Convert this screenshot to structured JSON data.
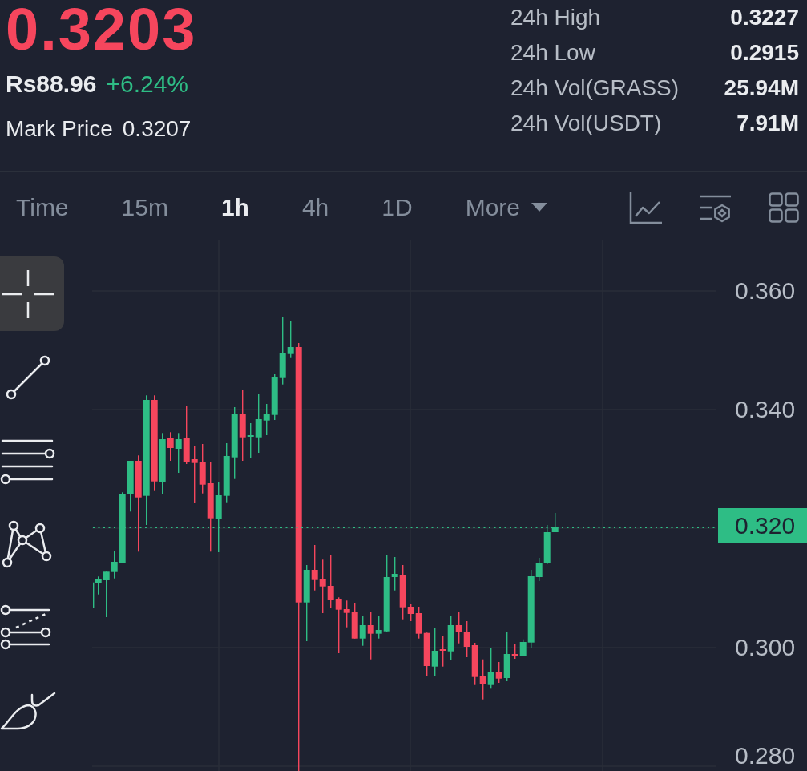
{
  "ticker": {
    "last_price": "0.3203",
    "fiat_price": "Rs88.96",
    "change": "+6.24%",
    "mark_price_label": "Mark Price",
    "mark_price": "0.3207"
  },
  "stats": [
    {
      "label": "24h High",
      "value": "0.3227"
    },
    {
      "label": "24h Low",
      "value": "0.2915"
    },
    {
      "label": "24h Vol(GRASS)",
      "value": "25.94M"
    },
    {
      "label": "24h Vol(USDT)",
      "value": "7.91M"
    }
  ],
  "intervals": [
    {
      "label": "Time",
      "selected": false,
      "kind": "tab"
    },
    {
      "label": "15m",
      "selected": false,
      "kind": "tab"
    },
    {
      "label": "1h",
      "selected": true,
      "kind": "tab"
    },
    {
      "label": "4h",
      "selected": false,
      "kind": "tab"
    },
    {
      "label": "1D",
      "selected": false,
      "kind": "tab"
    },
    {
      "label": "More",
      "selected": false,
      "kind": "menu"
    }
  ],
  "drawing_tools": [
    {
      "selected": true
    },
    {
      "selected": false
    },
    {
      "selected": false
    },
    {
      "selected": false
    },
    {
      "selected": false
    },
    {
      "selected": false
    }
  ],
  "chart": {
    "price_labels": [
      "0.360",
      "0.340",
      "0.300",
      "0.280"
    ],
    "last_price_tag": "0.320"
  }
}
